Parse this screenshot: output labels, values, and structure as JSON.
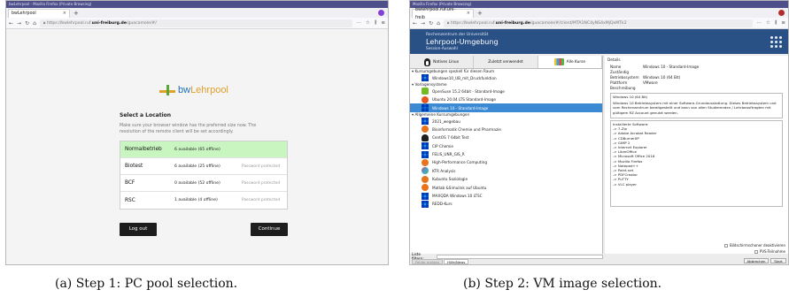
{
  "panel_a": {
    "window_title": "bwLehrpool - Mozilla Firefox (Private Browsing)",
    "tab_label": "bwLehrpool",
    "url_prefix": "https://bwlehrpool.ruf.",
    "url_domain": "uni-freiburg.de",
    "url_suffix": "/guacamole/#/",
    "logo_left": "bw",
    "logo_right": "Lehrpool",
    "location_title": "Select a Location",
    "location_desc": "Make sure your browser window has the preferred size now. The resolution of the remote client will be set accordingly.",
    "locations": [
      {
        "name": "Normalbetrieb",
        "availability": "6 available (65 offline)",
        "note": "",
        "selected": true
      },
      {
        "name": "Biotest",
        "availability": "6 available (25 offline)",
        "note": "Password protected",
        "selected": false
      },
      {
        "name": "BCF",
        "availability": "0 available (52 offline)",
        "note": "Password protected",
        "selected": false
      },
      {
        "name": "RSC",
        "availability": "1 available (4 offline)",
        "note": "Password protected",
        "selected": false
      }
    ],
    "logout_label": "Log out",
    "continue_label": "Continue",
    "caption": "(a) Step 1: PC pool selection."
  },
  "panel_b": {
    "window_title": "Mozilla Firefox (Private Browsing)",
    "tab_label": "bwlehrpool.ruf.uni-freib",
    "url_prefix": "https://bwlehrpool.ruf.",
    "url_domain": "uni-freiburg.de",
    "url_suffix": "/guacamole/#/client/MTA1NC4yNS4xMjQxMTk2",
    "header_small": "Rechenzentrum der Universität",
    "header_title": "Lehrpool-Umgebung",
    "header_sub": "Session-Auswahl",
    "tabs": [
      "Natives Linux",
      "Zuletzt verwendet",
      "Alle Kurse"
    ],
    "groups": [
      {
        "label": "Kursumgebungen speziell für diesen Raum",
        "items": [
          {
            "label": "Windows10_UB_mit_Druckfunktion",
            "icon": "windows-icon",
            "selected": false
          }
        ]
      },
      {
        "label": "Vorlagensysteme",
        "items": [
          {
            "label": "OpenSuse 15.2 64bit - Standard-Image",
            "icon": "suse-icon",
            "selected": false
          },
          {
            "label": "Ubuntu 20.04 LTS Standard-Image",
            "icon": "ubuntu-icon",
            "selected": false
          },
          {
            "label": "Windows 10 - Standard-Image",
            "icon": "windows-icon",
            "selected": true
          }
        ]
      },
      {
        "label": "Allgemeine Kursumgebungen",
        "items": [
          {
            "label": "2021_wegebau",
            "icon": "windows-icon",
            "selected": false
          },
          {
            "label": "Bioinformatik Chemie und Pharmazie",
            "icon": "orange-icon",
            "selected": false
          },
          {
            "label": "CentOS 7 64bit Test",
            "icon": "tux-icon",
            "selected": false
          },
          {
            "label": "CIP Chemie",
            "icon": "windows-icon",
            "selected": false
          },
          {
            "label": "FELIS_UNR_GIS_R",
            "icon": "windows-icon",
            "selected": false
          },
          {
            "label": "High-Performance Computing",
            "icon": "orange-icon",
            "selected": false
          },
          {
            "label": "KTR Analysis",
            "icon": "mixed-icon",
            "selected": false
          },
          {
            "label": "Kubuntu Soziologie",
            "icon": "orange-icon",
            "selected": false
          },
          {
            "label": "Matlab &Simulink auf Ubuntu",
            "icon": "orange-icon",
            "selected": false
          },
          {
            "label": "MAXQDA Windows 10 LTSC",
            "icon": "windows-icon",
            "selected": false
          },
          {
            "label": "REDD-Kurs",
            "icon": "windows-icon",
            "selected": false
          }
        ]
      }
    ],
    "filter_label": "Liste filtern:",
    "filter_tabs": [
      "Fehler melden",
      "Hilfe/News"
    ],
    "details_title": "Details",
    "details": [
      {
        "key": "Name",
        "value": "Windows 10 - Standard-Image"
      },
      {
        "key": "Zuständig",
        "value": ""
      },
      {
        "key": "Betriebssystem",
        "value": "Windows 10 (64 Bit)"
      },
      {
        "key": "Plattform",
        "value": "VMware"
      },
      {
        "key": "Beschreibung",
        "value": ""
      }
    ],
    "desc_lines": [
      "Windows 10 (64 Bit)",
      "Windows 10 Betriebssystem mit einer Software-Grundausstattung. Dieses Betriebssystem und",
      "vom Rechenzentrum bereitgestellt und kann von allen Studierenden / Lehrbeauftragten mit",
      "gültigem RZ Account genutzt werden."
    ],
    "software_lines": [
      "Installierte Software:",
      "-> 7-Zip",
      "-> Adobe Acrobat Reader",
      "-> CDBurnerXP",
      "-> GIMP 2",
      "-> Internet Explorer",
      "-> LibreOffice",
      "-> Microsoft Office 2016",
      "-> Mozilla Firefox",
      "-> Notepad++",
      "-> Paint.net",
      "-> PDFCreator",
      "-> PuTTY",
      "-> VLC player"
    ],
    "check_1": "Bildschirmschoner deaktivieren",
    "check_2": "PVS-Teilnahme",
    "cancel_label": "Abbrechen",
    "start_label": "Start",
    "caption": "(b) Step 2: VM image selection."
  }
}
